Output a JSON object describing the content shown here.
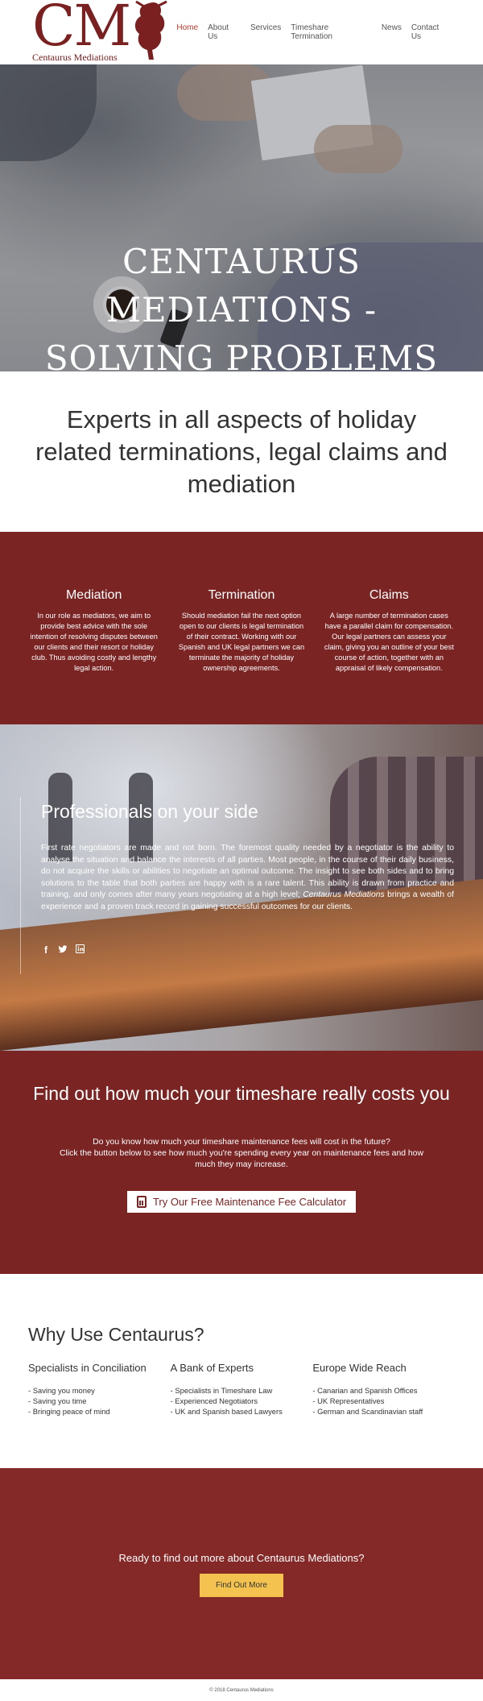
{
  "brand": {
    "logo_letters": "CM",
    "logo_name": "Centaurus Mediations"
  },
  "nav": [
    {
      "label": "Home",
      "active": true
    },
    {
      "label": "About Us",
      "active": false
    },
    {
      "label": "Services",
      "active": false
    },
    {
      "label": "Timeshare Termination",
      "active": false
    },
    {
      "label": "News",
      "active": false
    },
    {
      "label": "Contact Us",
      "active": false
    }
  ],
  "hero": {
    "title_line1": "CENTAURUS MEDIATIONS -",
    "title_line2": "SOLVING PROBLEMS"
  },
  "experts": {
    "heading": "Experts in all aspects of holiday related terminations, legal claims and mediation"
  },
  "services": [
    {
      "title": "Mediation",
      "text": "In our role as mediators, we aim to provide best advice with the sole intention of resolving disputes between our clients and their resort or holiday club. Thus avoiding costly and lengthy legal action."
    },
    {
      "title": "Termination",
      "text": "Should mediation fail the next option open to our clients is legal termination of their contract. Working with our Spanish and UK legal partners we can terminate the majority of holiday ownership agreements."
    },
    {
      "title": "Claims",
      "text": "A large number of termination cases have a parallel claim for compensation. Our legal partners can assess your claim, giving you an outline of your best course of action, together with an appraisal of likely compensation."
    }
  ],
  "professionals": {
    "heading": "Professionals on your side",
    "text_before": "First rate negotiators are made and not born. The foremost quality needed by a negotiator is the ability to analyse the situation and balance the interests of all parties. Most people, in the course of their daily business, do not acquire the skills or abilities to negotiate an optimal outcome. The insight to see both sides and to bring solutions to the table that both parties are happy with is a rare talent. This ability is drawn from practice and training, and only comes after many years negotiating at a high level; ",
    "text_em": "Centaurus Mediations",
    "text_after": " brings a wealth of experience and a proven track record in gaining successful outcomes for our clients.",
    "social": [
      "facebook-icon",
      "twitter-icon",
      "linkedin-icon"
    ]
  },
  "calculator": {
    "heading": "Find out how much your timeshare really costs you",
    "line1": "Do you know how much your timeshare maintenance fees will cost in the future?",
    "line2": "Click the button below to see how much you're spending every year on maintenance fees and how much they may increase.",
    "button": "Try Our Free Maintenance Fee Calculator"
  },
  "why": {
    "heading": "Why Use Centaurus?",
    "columns": [
      {
        "title": "Specialists in Conciliation",
        "items": [
          "- Saving you money",
          "- Saving you time",
          "- Bringing peace of mind"
        ]
      },
      {
        "title": "A Bank of Experts",
        "items": [
          "- Specialists in Timeshare Law",
          "- Experienced Negotiators",
          "- UK and Spanish based Lawyers"
        ]
      },
      {
        "title": "Europe Wide Reach",
        "items": [
          "- Canarian and Spanish Offices",
          "- UK Representatives",
          "- German and Scandinavian staff"
        ]
      }
    ]
  },
  "cta": {
    "heading": "Ready to find out more about Centaurus Mediations?",
    "button": "Find Out More"
  },
  "footer": {
    "text": "© 2018 Centaurus Mediations"
  },
  "colors": {
    "brand": "#7a2424",
    "cta_bg": "#842828",
    "cta_button": "#f3c24f",
    "nav_active": "#c0392b"
  }
}
